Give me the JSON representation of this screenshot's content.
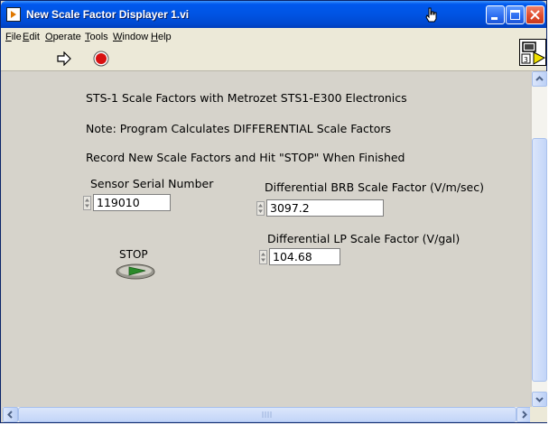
{
  "window": {
    "title": "New Scale Factor Displayer 1.vi"
  },
  "menu": {
    "items": [
      {
        "mnemonic": "F",
        "rest": "ile"
      },
      {
        "mnemonic": "E",
        "rest": "dit"
      },
      {
        "mnemonic": "O",
        "rest": "perate"
      },
      {
        "mnemonic": "T",
        "rest": "ools"
      },
      {
        "mnemonic": "W",
        "rest": "indow"
      },
      {
        "mnemonic": "H",
        "rest": "elp"
      }
    ]
  },
  "toolbar": {
    "run_icon": "run-arrow-icon",
    "stop_icon": "abort-execution-icon",
    "vi_icon_text": "3"
  },
  "panel": {
    "line1": "STS-1 Scale Factors with Metrozet STS1-E300 Electronics",
    "line2": "Note: Program Calculates DIFFERENTIAL Scale Factors",
    "line3": "Record New Scale Factors and Hit \"STOP\" When Finished",
    "serial": {
      "label": "Sensor Serial Number",
      "value": "119010"
    },
    "brb": {
      "label": "Differential BRB Scale Factor (V/m/sec)",
      "value": "3097.2"
    },
    "lp": {
      "label": "Differential LP Scale Factor (V/gal)",
      "value": "104.68"
    },
    "stop": {
      "label": "STOP"
    }
  },
  "colors": {
    "titlebar": "#0054e3",
    "panel_bg": "#d6d3cb",
    "menu_bg": "#ece9d8",
    "stop_led": "#2a8a2a"
  }
}
